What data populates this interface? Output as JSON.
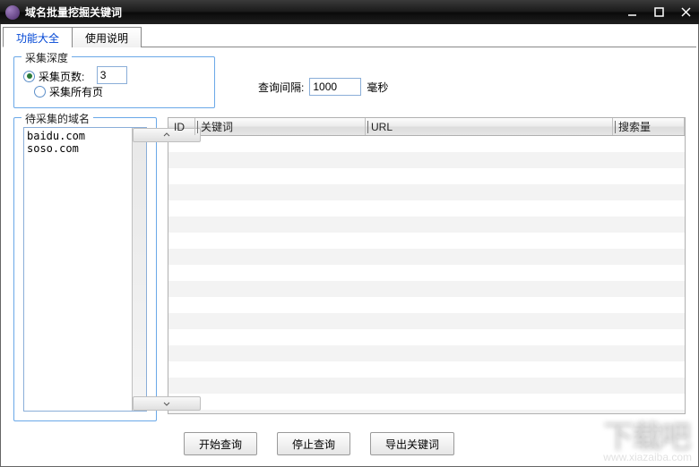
{
  "titlebar": {
    "title": "域名批量挖掘关键词"
  },
  "tabs": [
    {
      "label": "功能大全",
      "active": true
    },
    {
      "label": "使用说明",
      "active": false
    }
  ],
  "depth": {
    "legend": "采集深度",
    "page_count_label": "采集页数:",
    "page_count_value": "3",
    "all_pages_label": "采集所有页"
  },
  "interval": {
    "label": "查询间隔:",
    "value": "1000",
    "unit": "毫秒"
  },
  "domains": {
    "legend": "待采集的域名",
    "list": "baidu.com\nsoso.com"
  },
  "grid": {
    "columns": {
      "id": "ID",
      "keyword": "关键词",
      "url": "URL",
      "volume": "搜索量"
    }
  },
  "buttons": {
    "start": "开始查询",
    "stop": "停止查询",
    "export": "导出关键词"
  },
  "watermark": {
    "main": "下载吧",
    "sub": "www.xiazaiba.com"
  }
}
